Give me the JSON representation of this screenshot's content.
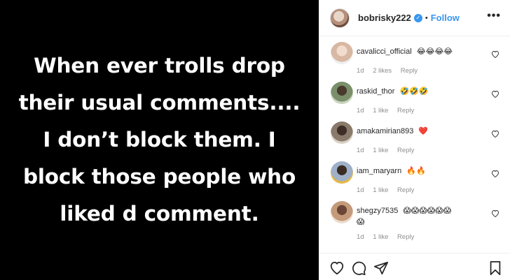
{
  "post": {
    "lines": [
      "When ever trolls drop",
      "their usual comments....",
      "I don’t block them. I",
      "block those people who",
      "liked d comment."
    ]
  },
  "header": {
    "username": "bobrisky222",
    "separator": "•",
    "follow_label": "Follow",
    "more_label": "•••"
  },
  "comments": [
    {
      "user": "cavalicci_official",
      "text": "😂😂😂😂",
      "age": "1d",
      "likes": "2 likes",
      "reply": "Reply",
      "avatar_color": "#d8b7a3"
    },
    {
      "user": "raskid_thor",
      "text": "🤣🤣🤣",
      "age": "1d",
      "likes": "1 like",
      "reply": "Reply",
      "avatar_color": "#7a8f6a"
    },
    {
      "user": "amakamirian893",
      "text": "❤️",
      "age": "1d",
      "likes": "1 like",
      "reply": "Reply",
      "avatar_color": "#8a7a6b"
    },
    {
      "user": "iam_maryarn",
      "text": "🔥🔥",
      "age": "1d",
      "likes": "1 like",
      "reply": "Reply",
      "avatar_color": "#9fb0c8"
    },
    {
      "user": "shegzy7535",
      "text": "😱😱😱😱😱😱",
      "text2": "😱",
      "age": "1d",
      "likes": "1 like",
      "reply": "Reply",
      "avatar_color": "#c49a7a"
    }
  ],
  "colors": {
    "follow": "#3897f0",
    "verified": "#3897f0",
    "meta": "#8e8e8e",
    "post_background": "#000000",
    "post_text": "#ffffff"
  },
  "icons": [
    "heart-icon",
    "comment-icon",
    "share-icon",
    "bookmark-icon",
    "more-icon",
    "verified-icon"
  ]
}
